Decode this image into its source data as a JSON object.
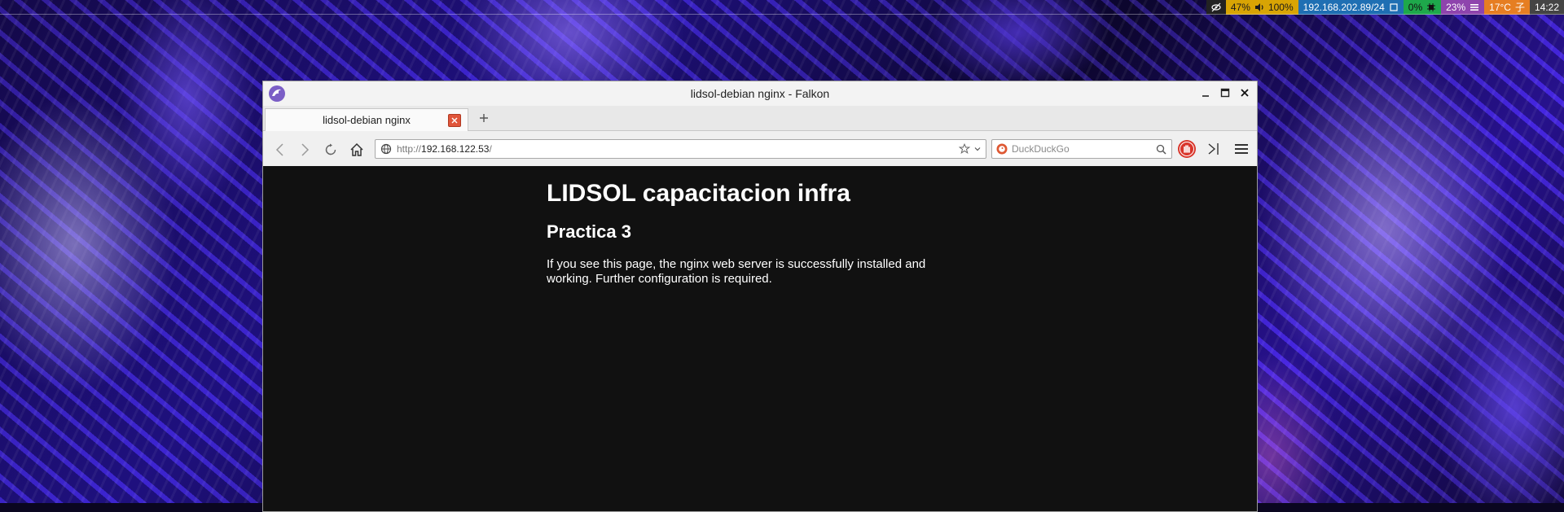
{
  "statusbar": {
    "battery_percent": "47%",
    "volume_percent": "100%",
    "ip_address": "192.168.202.89/24",
    "cpu_percent": "0%",
    "memory_percent": "23%",
    "temperature": "17°C",
    "weather_glyph": "子",
    "clock": "14:22"
  },
  "window": {
    "title": "lidsol-debian nginx - Falkon"
  },
  "tabs": [
    {
      "label": "lidsol-debian nginx"
    }
  ],
  "navbar": {
    "url_scheme": "http://",
    "url_host": "192.168.122.53",
    "url_path": "/",
    "search_placeholder": "DuckDuckGo"
  },
  "page": {
    "heading": "LIDSOL capacitacion infra",
    "subheading": "Practica 3",
    "body": "If you see this page, the nginx web server is successfully installed and working. Further configuration is required."
  },
  "colors": {
    "page_background": "#111111",
    "battery_segment": "#d8a404",
    "network_segment": "#1f6fb3",
    "cpu_segment": "#1ea84b",
    "memory_segment": "#8e44ad",
    "temp_segment": "#e67e22"
  }
}
